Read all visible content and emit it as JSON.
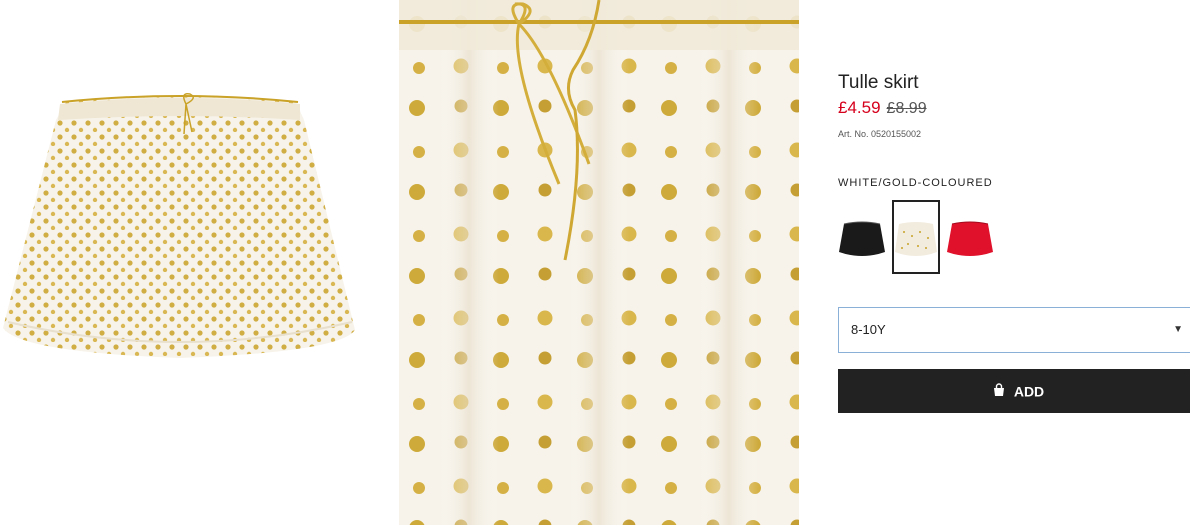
{
  "product": {
    "title": "Tulle skirt",
    "sale_price": "£4.59",
    "original_price": "£8.99",
    "article_number": "Art. No. 0520155002",
    "color_name": "WHITE/GOLD-COLOURED"
  },
  "swatches": [
    {
      "icon": "black-skirt-swatch",
      "color": "#1a1a1a",
      "selected": false
    },
    {
      "icon": "white-gold-skirt-swatch",
      "color": "#f4efe4",
      "selected": true
    },
    {
      "icon": "red-skirt-swatch",
      "color": "#e0112b",
      "selected": false
    }
  ],
  "size_select": {
    "value": "8-10Y",
    "icon": "chevron-down-icon"
  },
  "add_button": {
    "label": "ADD",
    "icon": "shopping-bag-icon"
  },
  "colors": {
    "sale": "#d6001c",
    "button": "#222222",
    "dots": "#c9a227"
  }
}
